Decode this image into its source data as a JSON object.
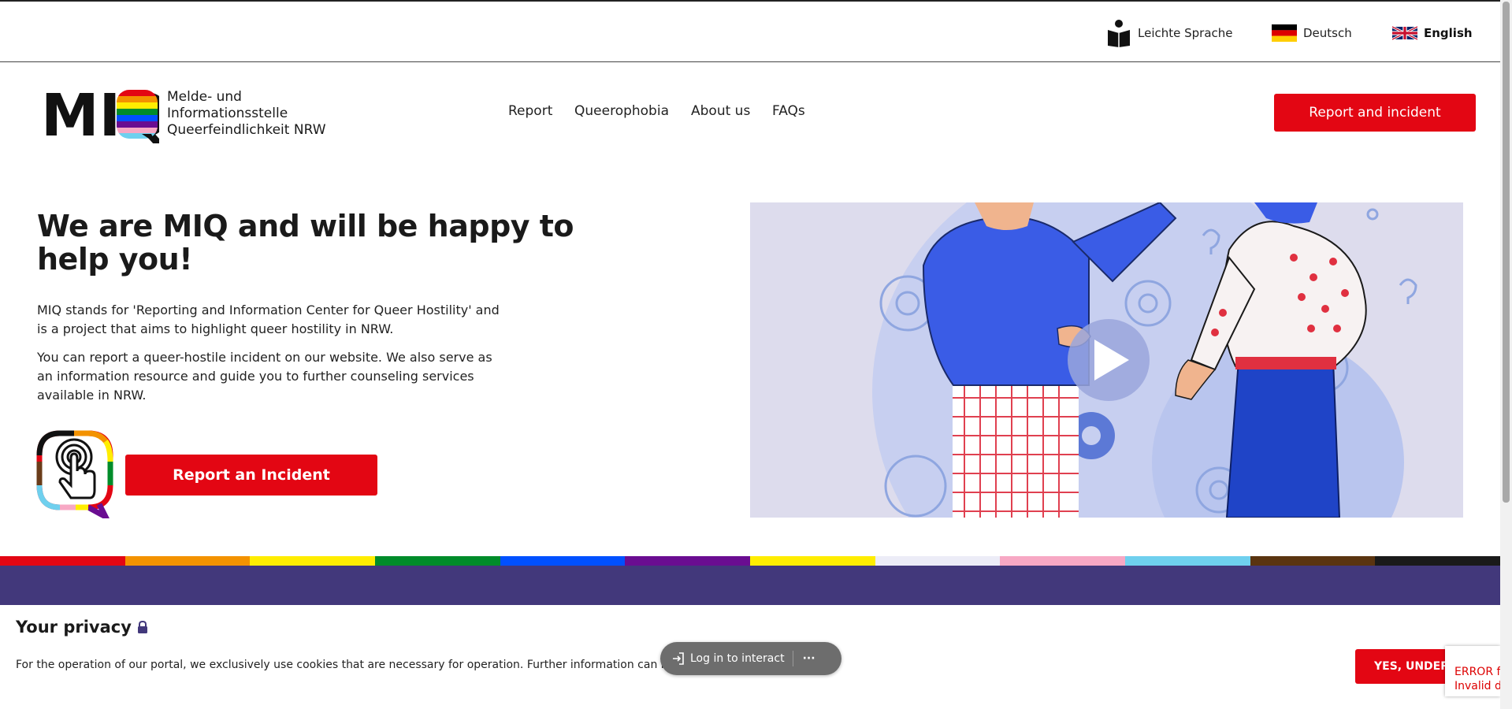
{
  "lang_bar": {
    "easy_language": "Leichte Sprache",
    "german": "Deutsch",
    "english": "English"
  },
  "logo": {
    "mark": "MIQ",
    "line1": "Melde- und",
    "line2": "Informationsstelle",
    "line3": "Queerfeindlichkeit NRW"
  },
  "nav": {
    "report": "Report",
    "queerophobia": "Queerophobia",
    "about": "About us",
    "faqs": "FAQs"
  },
  "header_cta": "Report and incident",
  "hero": {
    "title": "We are MIQ and will be happy to help you!",
    "p1": "MIQ stands for 'Reporting and Information Center for Queer Hostility' and is a project that aims to highlight queer hostility in NRW.",
    "p2": "You can report a queer-hostile incident on our website. We also serve as an information resource and guide you to further counseling services available in NRW.",
    "cta": "Report an Incident"
  },
  "rainbow_colors": [
    "#e30613",
    "#f39200",
    "#ffed00",
    "#008c2a",
    "#0050ff",
    "#6a0d91",
    "#ffed00",
    "#ececf7",
    "#f7a8c4",
    "#6fd0ee",
    "#5a3410",
    "#1a1a1a"
  ],
  "privacy": {
    "title": "Your privacy",
    "text": "For the operation of our portal, we exclusively use cookies that are necessary for operation. Further information can be",
    "accept": "YES, UNDERSTOOD"
  },
  "login_pill": {
    "label": "Log in to interact",
    "more": "···"
  },
  "recaptcha": {
    "line1": "ERROR for",
    "line2": "Invalid do"
  },
  "icons": {
    "easy_language": "reading-person-icon",
    "german": "germany-flag-icon",
    "english": "uk-flag-icon",
    "lock": "lock-icon",
    "login": "login-arrow-icon",
    "play": "play-icon",
    "touch": "touch-hand-icon"
  },
  "colors": {
    "accent_red": "#e30613",
    "band_purple": "#42387b"
  }
}
